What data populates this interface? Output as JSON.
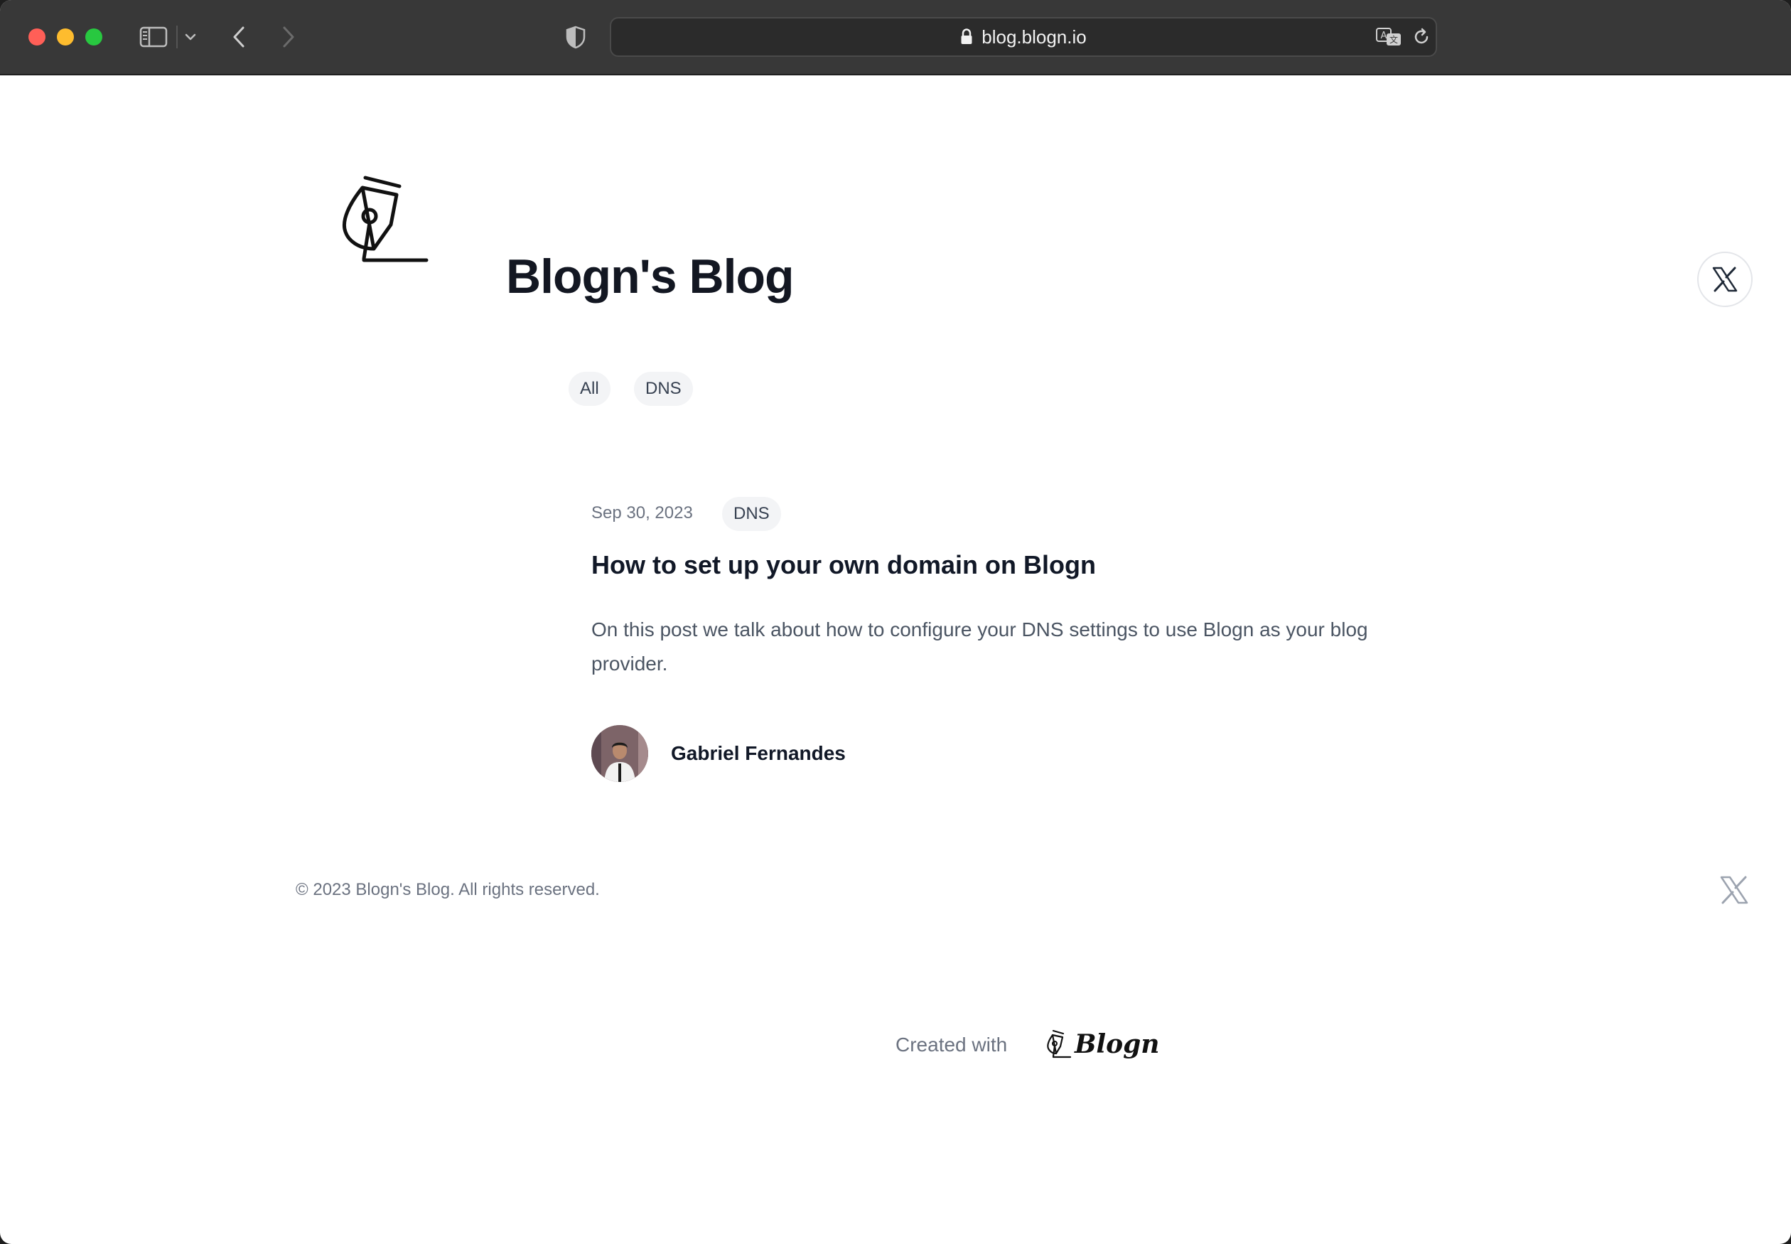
{
  "browser": {
    "url": "blog.blogn.io"
  },
  "site": {
    "title": "Blogn's Blog"
  },
  "filters": {
    "items": [
      {
        "label": "All"
      },
      {
        "label": "DNS"
      }
    ]
  },
  "post": {
    "date": "Sep 30, 2023",
    "category": "DNS",
    "title": "How to set up your own domain on Blogn",
    "excerpt": "On this post we talk about how to configure your DNS settings to use Blogn as your blog provider.",
    "author": "Gabriel Fernandes"
  },
  "footer": {
    "copyright": "© 2023 Blogn's Blog. All rights reserved.",
    "created_with": "Created with",
    "brand": "Blogn"
  },
  "icons": {
    "toolbar": [
      "sidebar-icon",
      "chevron-down-icon",
      "back-arrow-icon",
      "forward-arrow-icon",
      "shield-icon",
      "lock-icon",
      "translate-icon",
      "reload-icon"
    ],
    "page": [
      "pen-nib-logo-icon",
      "x-logo-icon"
    ]
  },
  "colors": {
    "toolbar_bg": "#383838",
    "page_bg": "#ffffff",
    "tag_bg": "#f3f4f6",
    "title_text": "#131722",
    "muted_text": "#6b7280"
  }
}
